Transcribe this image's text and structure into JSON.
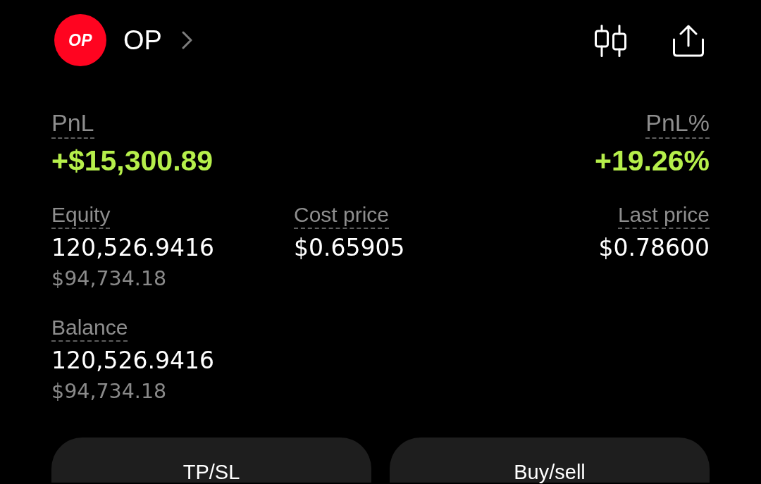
{
  "header": {
    "logo_text": "OP",
    "token": "OP"
  },
  "pnl": [
    {
      "label": "PnL",
      "value": "+$15,300.89",
      "positive": true
    },
    {
      "label": "PnL%",
      "value": "+19.26%",
      "positive": true
    }
  ],
  "stats": [
    {
      "label": "Equity",
      "value": "120,526.9416",
      "usd": "$94,734.18"
    },
    {
      "label": "Cost price",
      "value": "$0.65905"
    },
    {
      "label": "Last price",
      "value": "$0.78600"
    },
    {
      "label": "Balance",
      "value": "120,526.9416",
      "usd": "$94,734.18"
    }
  ],
  "buttons": [
    {
      "label": "TP/SL"
    },
    {
      "label": "Buy/sell"
    }
  ]
}
